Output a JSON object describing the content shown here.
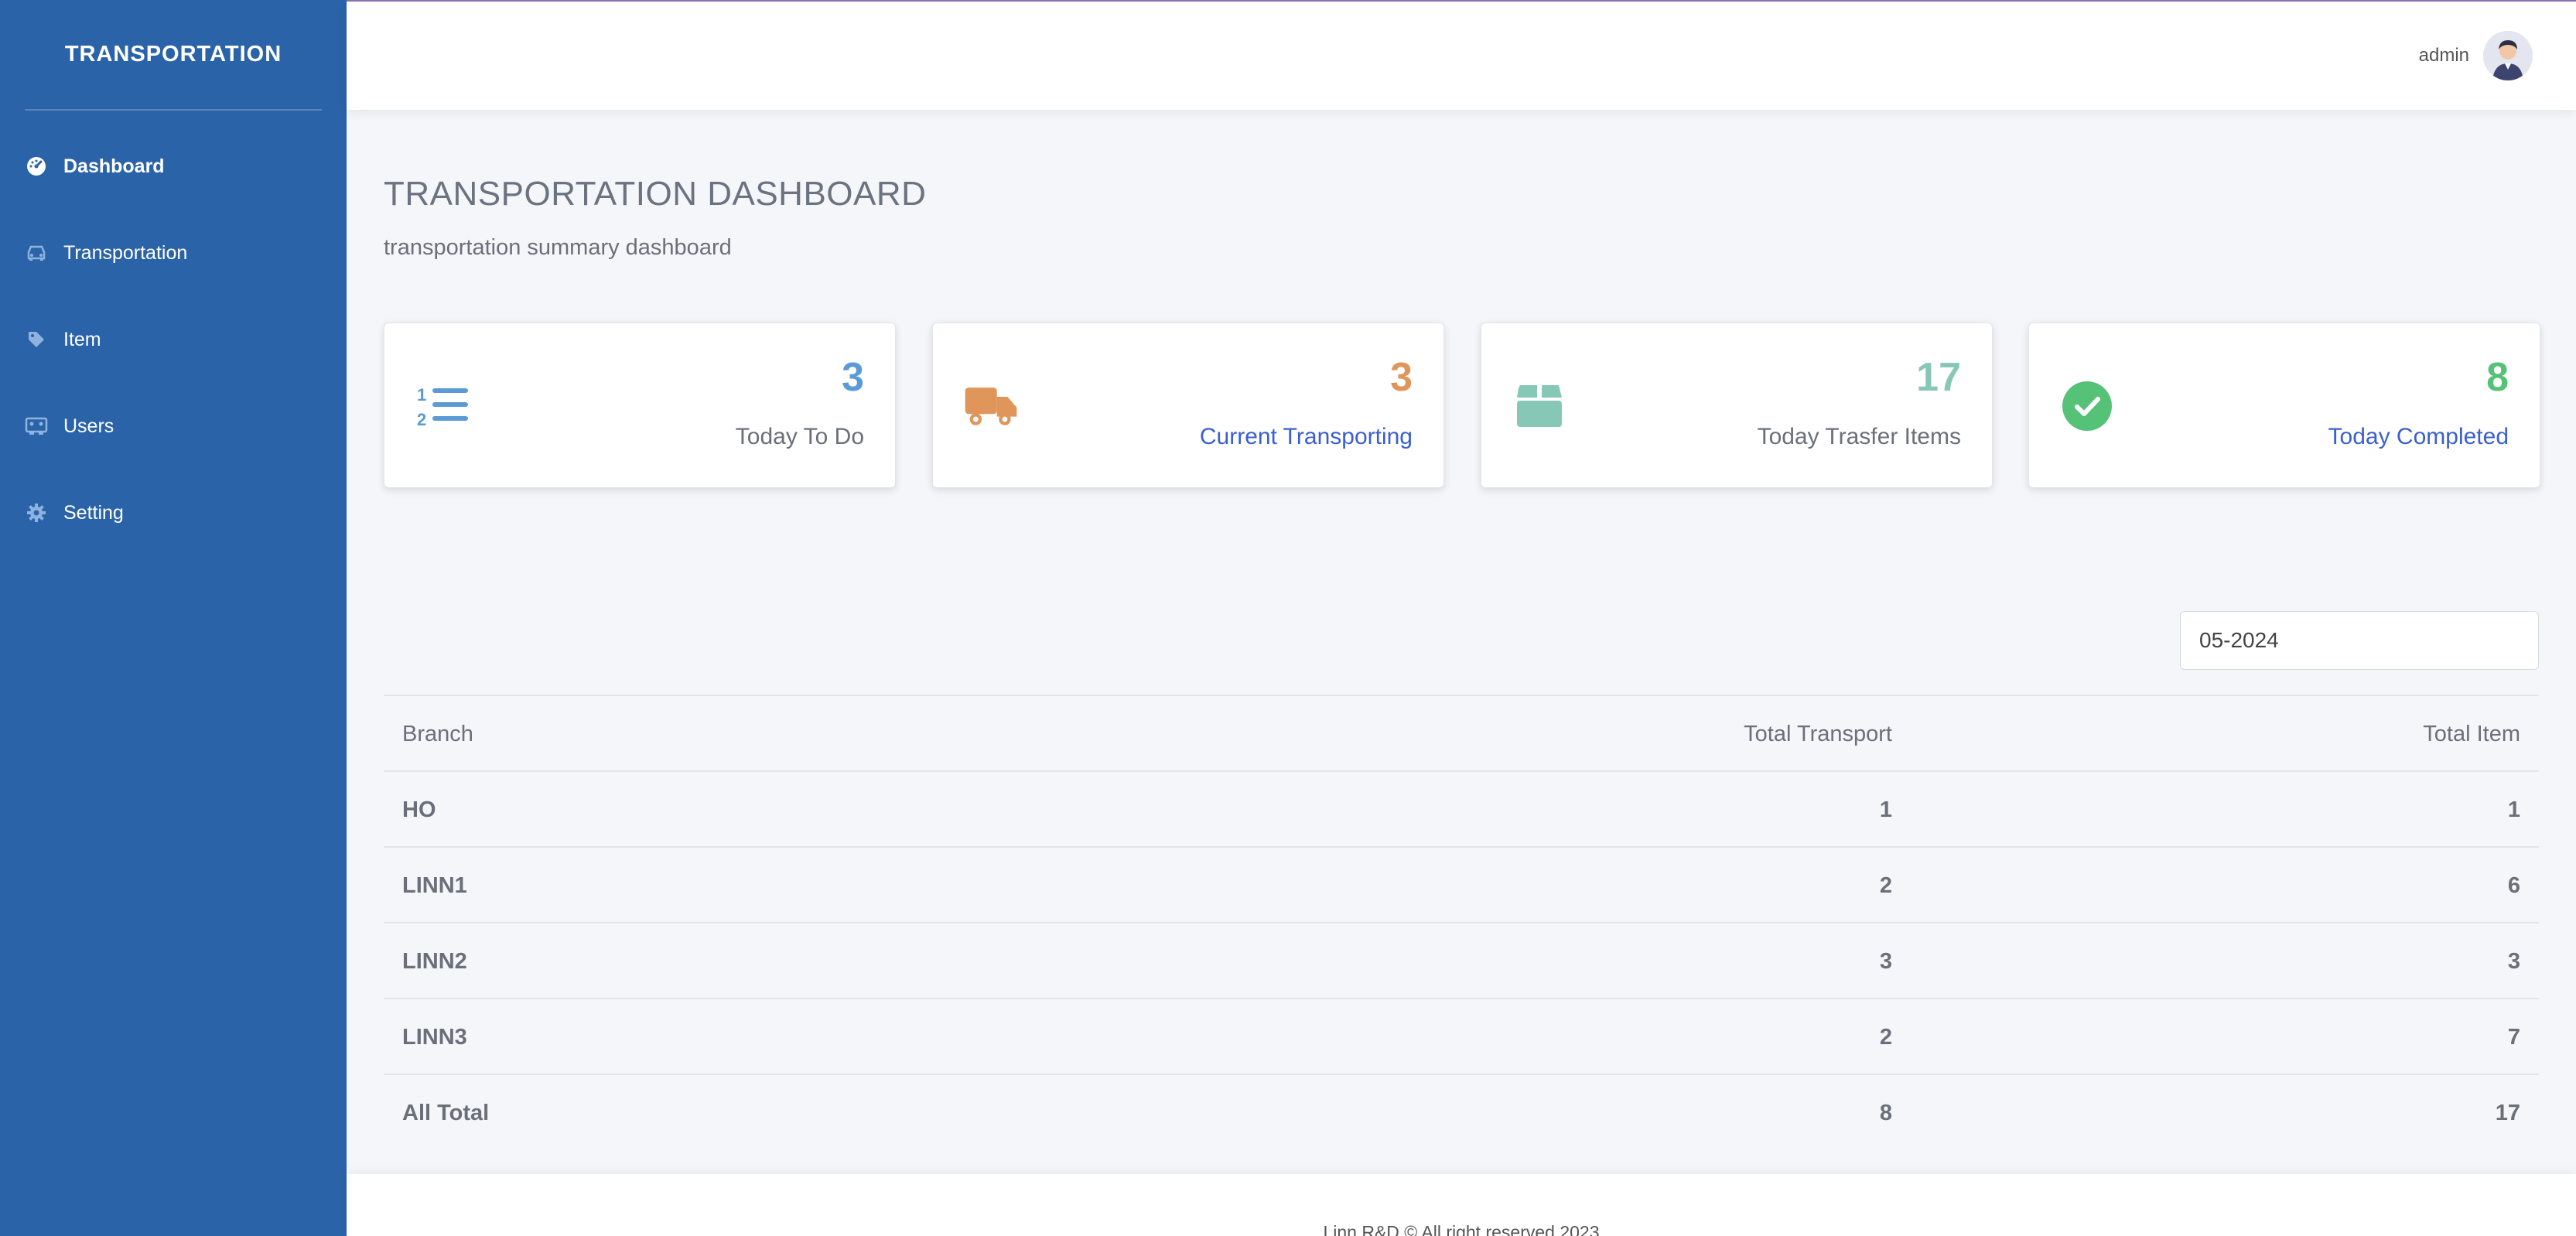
{
  "sidebar": {
    "brand": "TRANSPORTATION",
    "items": [
      {
        "label": "Dashboard",
        "icon": "gauge-icon"
      },
      {
        "label": "Transportation",
        "icon": "car-icon"
      },
      {
        "label": "Item",
        "icon": "tag-icon"
      },
      {
        "label": "Users",
        "icon": "users-icon"
      },
      {
        "label": "Setting",
        "icon": "gear-icon"
      }
    ]
  },
  "topbar": {
    "username": "admin"
  },
  "page": {
    "title": "TRANSPORTATION DASHBOARD",
    "subtitle": "transportation summary dashboard"
  },
  "cards": [
    {
      "value": "3",
      "label": "Today To Do",
      "icon": "list-ordered-icon",
      "color": "#5b9bd5",
      "label_color": "#6b6f7a"
    },
    {
      "value": "3",
      "label": "Current Transporting",
      "icon": "truck-icon",
      "color": "#e0965a",
      "label_color": "#3a5fcf"
    },
    {
      "value": "17",
      "label": "Today Trasfer Items",
      "icon": "box-icon",
      "color": "#86c7b5",
      "label_color": "#6b6f7a"
    },
    {
      "value": "8",
      "label": "Today Completed",
      "icon": "check-circle-icon",
      "color": "#55c277",
      "label_color": "#3a5fcf"
    }
  ],
  "filter": {
    "month_value": "05-2024"
  },
  "table": {
    "headers": [
      "Branch",
      "Total Transport",
      "Total Item"
    ],
    "rows": [
      [
        "HO",
        "1",
        "1"
      ],
      [
        "LINN1",
        "2",
        "6"
      ],
      [
        "LINN2",
        "3",
        "3"
      ],
      [
        "LINN3",
        "2",
        "7"
      ],
      [
        "All Total",
        "8",
        "17"
      ]
    ]
  },
  "footer": {
    "text": "Linn R&D © All right reserved 2023"
  },
  "colors": {
    "sidebar": "#2b63a8",
    "accent_blue": "#3a5fcf"
  }
}
